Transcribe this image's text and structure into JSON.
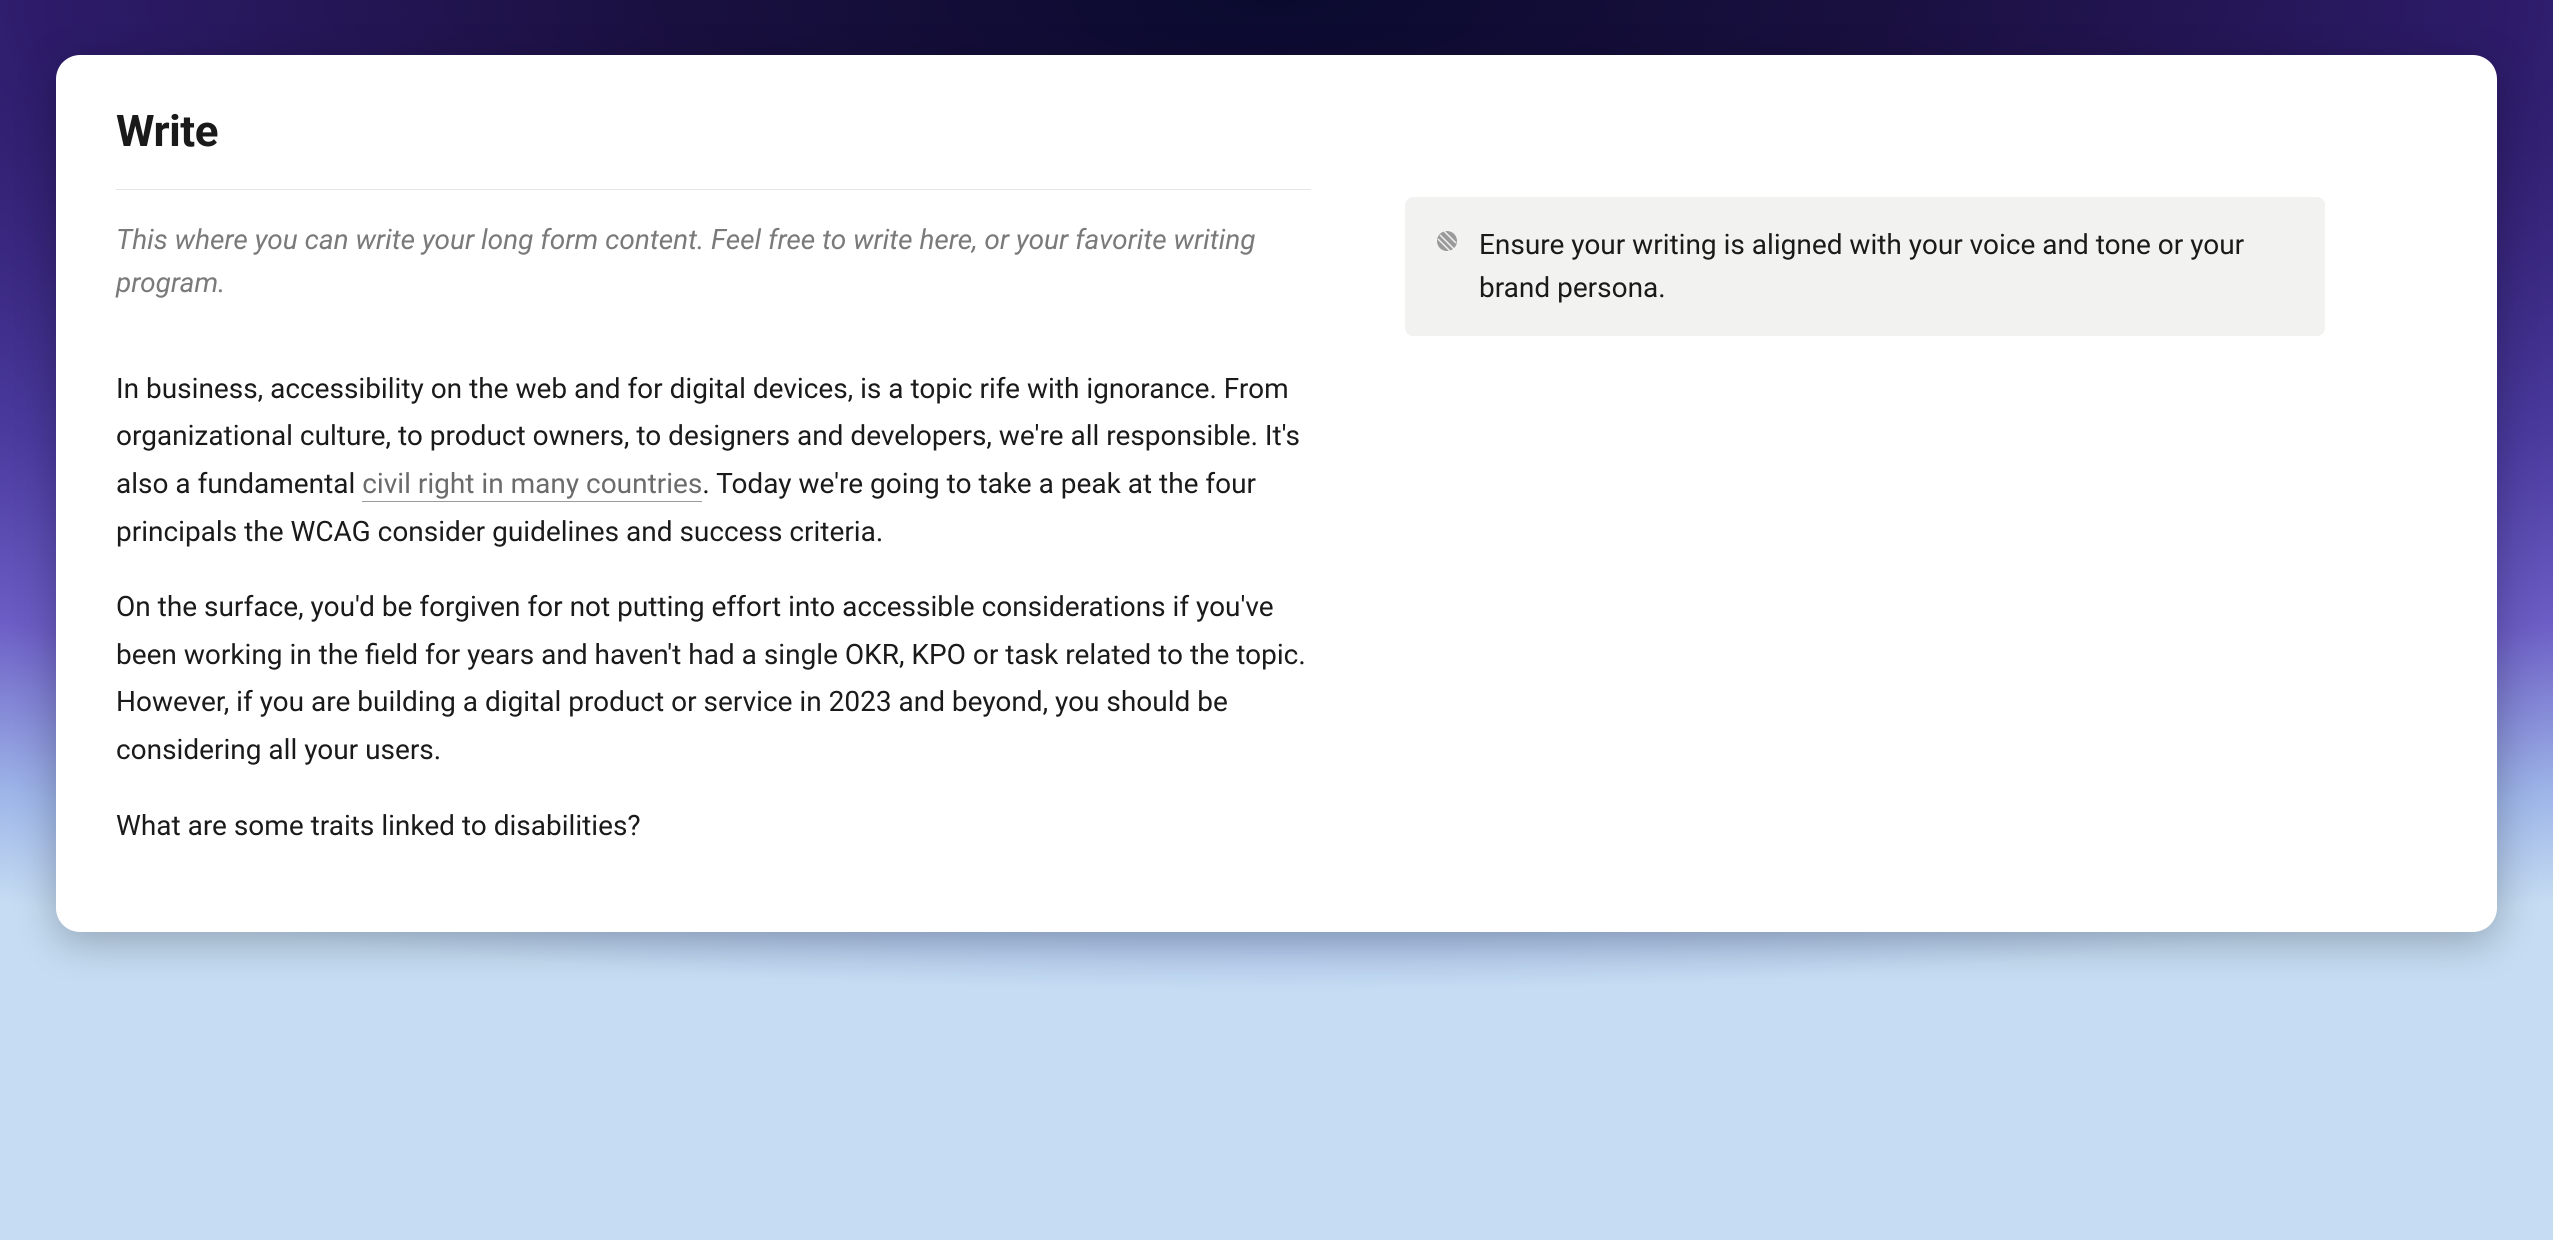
{
  "page": {
    "title": "Write"
  },
  "content": {
    "intro": "This where you can write your long form content. Feel free to write here, or your favorite writing program.",
    "paragraph1_part1": "In business, accessibility on the web and for digital devices, is a topic rife with ignorance. From organizational culture, to product owners, to designers and developers, we're all responsible. It's also a fundamental ",
    "paragraph1_link_text": "civil right in many countries",
    "paragraph1_part2": ". Today we're going to take a peak at the four principals the WCAG consider guidelines and success criteria.",
    "paragraph2": "On the surface, you'd be forgiven for not putting effort into accessible considerations if you've been working in the field for years and haven't had a single OKR, KPO or task related to the topic. However, if you are building a digital product or service in 2023 and beyond, you should be considering all your users.",
    "paragraph3": "What are some traits linked to disabilities?"
  },
  "tip": {
    "text": "Ensure your writing is aligned with your voice and tone or your brand persona."
  }
}
